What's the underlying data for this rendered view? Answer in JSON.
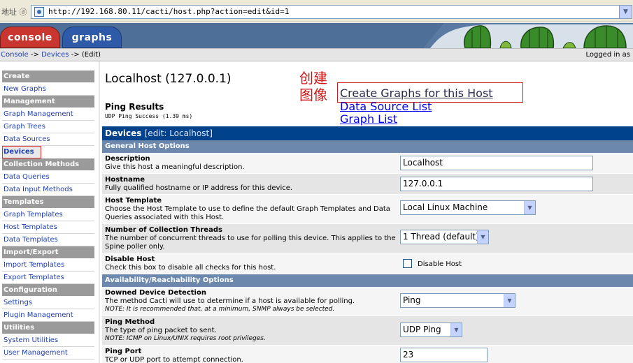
{
  "addressbar": {
    "label": "地址 ⓓ",
    "url": "http://192.168.80.11/cacti/host.php?action=edit&id=1"
  },
  "tabs": [
    {
      "label": "console"
    },
    {
      "label": "graphs"
    }
  ],
  "breadcrumb": {
    "console": "Console",
    "sep1": " -> ",
    "devices": "Devices",
    "sep2": " -> ",
    "current": "(Edit)",
    "login": "Logged in as"
  },
  "sidebar": {
    "items": [
      {
        "label": "Create",
        "type": "header"
      },
      {
        "label": "New Graphs",
        "type": "item"
      },
      {
        "label": "Management",
        "type": "header"
      },
      {
        "label": "Graph Management",
        "type": "item"
      },
      {
        "label": "Graph Trees",
        "type": "item"
      },
      {
        "label": "Data Sources",
        "type": "item"
      },
      {
        "label": "Devices",
        "type": "selected"
      },
      {
        "label": "Collection Methods",
        "type": "header"
      },
      {
        "label": "Data Queries",
        "type": "item"
      },
      {
        "label": "Data Input Methods",
        "type": "item"
      },
      {
        "label": "Templates",
        "type": "header"
      },
      {
        "label": "Graph Templates",
        "type": "item"
      },
      {
        "label": "Host Templates",
        "type": "item"
      },
      {
        "label": "Data Templates",
        "type": "item"
      },
      {
        "label": "Import/Export",
        "type": "header"
      },
      {
        "label": "Import Templates",
        "type": "item"
      },
      {
        "label": "Export Templates",
        "type": "item"
      },
      {
        "label": "Configuration",
        "type": "header"
      },
      {
        "label": "Settings",
        "type": "item"
      },
      {
        "label": "Plugin Management",
        "type": "item"
      },
      {
        "label": "Utilities",
        "type": "header"
      },
      {
        "label": "System Utilities",
        "type": "item"
      },
      {
        "label": "User Management",
        "type": "item"
      }
    ]
  },
  "main": {
    "title": "Localhost (127.0.0.1)",
    "ping": {
      "title": "Ping Results",
      "status": "UDP Ping Success (1.39 ms)"
    },
    "annotation": {
      "line1": "创建",
      "line2": "图像"
    },
    "links": {
      "create_graphs": "Create Graphs for this Host",
      "data_source_list": "Data Source List",
      "graph_list": "Graph List"
    }
  },
  "form": {
    "title": "Devices",
    "subtitle": "[edit: Localhost]",
    "sections": {
      "general": "General Host Options",
      "availability": "Availability/Reachability Options"
    },
    "fields": {
      "description": {
        "name": "Description",
        "desc": "Give this host a meaningful description.",
        "value": "Localhost"
      },
      "hostname": {
        "name": "Hostname",
        "desc": "Fully qualified hostname or IP address for this device.",
        "value": "127.0.0.1"
      },
      "host_template": {
        "name": "Host Template",
        "desc": "Choose the Host Template to use to define the default Graph Templates and Data Queries associated with this Host.",
        "value": "Local Linux Machine"
      },
      "threads": {
        "name": "Number of Collection Threads",
        "desc": "The number of concurrent threads to use for polling this device. This applies to the Spine poller only.",
        "value": "1 Thread (default)"
      },
      "disable_host": {
        "name": "Disable Host",
        "desc": "Check this box to disable all checks for this host.",
        "checkbox_label": "Disable Host",
        "checked": false
      },
      "downed_detection": {
        "name": "Downed Device Detection",
        "desc": "The method Cacti will use to determine if a host is available for polling.",
        "note": "NOTE: It is recommended that, at a minimum, SNMP always be selected.",
        "value": "Ping"
      },
      "ping_method": {
        "name": "Ping Method",
        "desc": "The type of ping packet to sent.",
        "note": "NOTE: ICMP on Linux/UNIX requires root privileges.",
        "value": "UDP Ping"
      },
      "ping_port": {
        "name": "Ping Port",
        "desc": "TCP or UDP port to attempt connection.",
        "value": "23"
      }
    }
  }
}
